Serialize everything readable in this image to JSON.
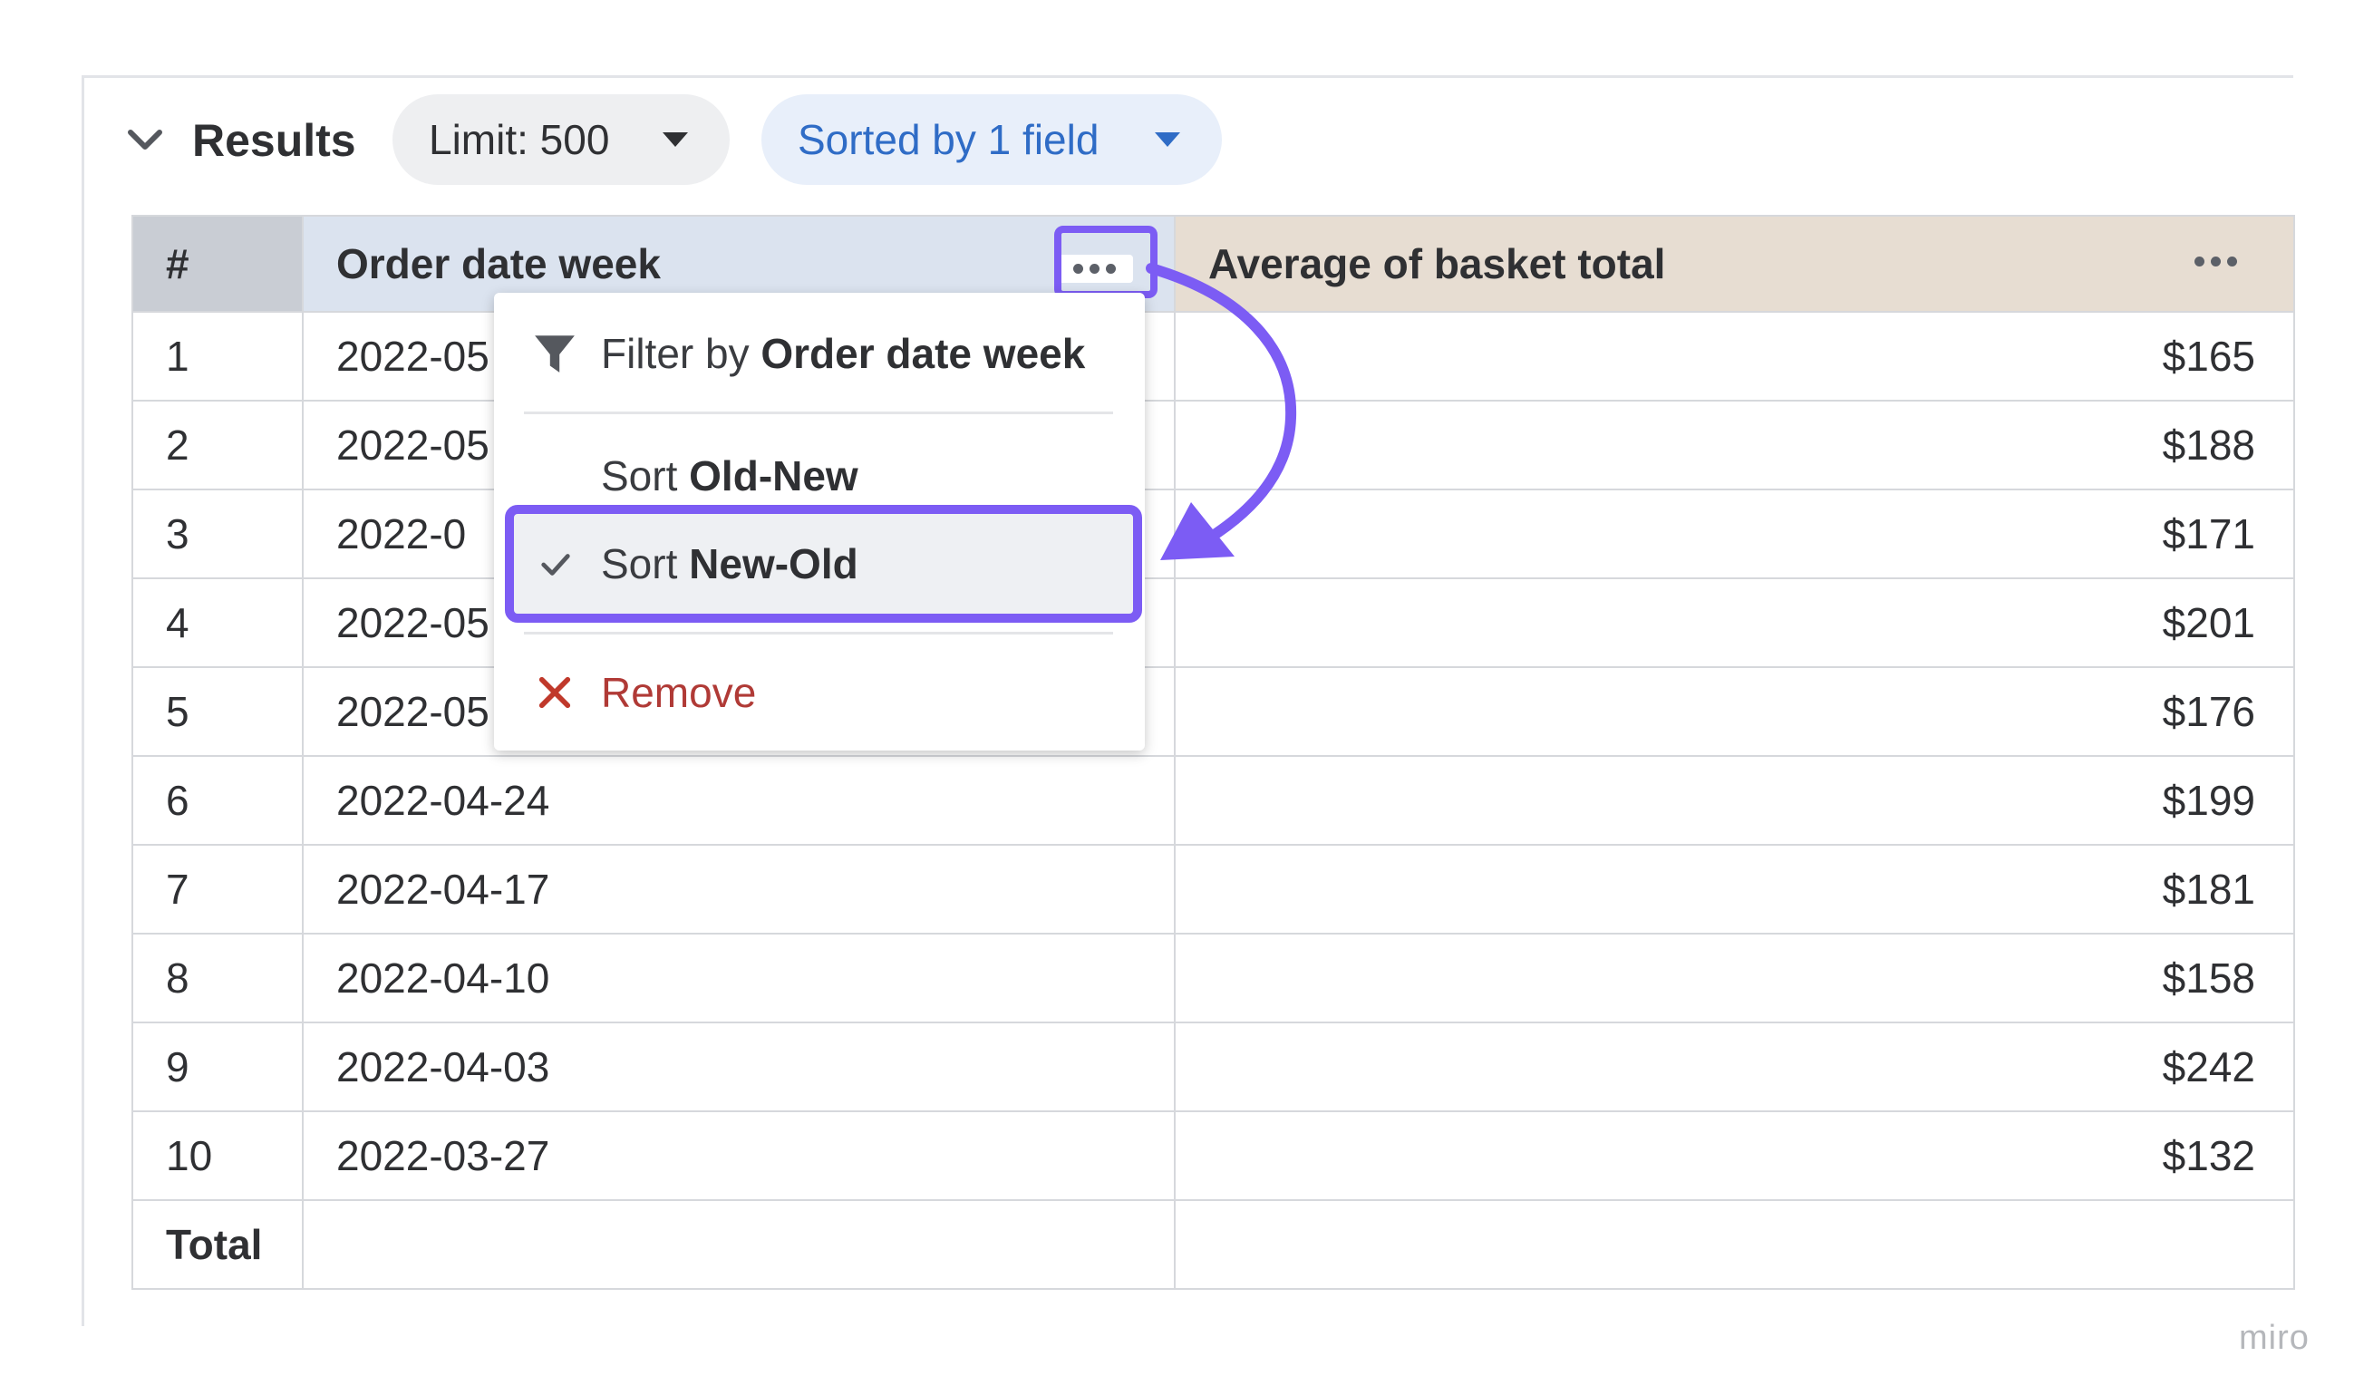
{
  "header": {
    "title": "Results",
    "limit_label": "Limit: 500",
    "sorted_label": "Sorted by 1 field"
  },
  "table": {
    "columns": [
      "#",
      "Order date week",
      "Average of basket total"
    ],
    "rows": [
      {
        "n": "1",
        "date": "2022-05",
        "avg": "$165"
      },
      {
        "n": "2",
        "date": "2022-05",
        "avg": "$188"
      },
      {
        "n": "3",
        "date": "2022-0",
        "avg": "$171"
      },
      {
        "n": "4",
        "date": "2022-05",
        "avg": "$201"
      },
      {
        "n": "5",
        "date": "2022-05",
        "avg": "$176"
      },
      {
        "n": "6",
        "date": "2022-04-24",
        "avg": "$199"
      },
      {
        "n": "7",
        "date": "2022-04-17",
        "avg": "$181"
      },
      {
        "n": "8",
        "date": "2022-04-10",
        "avg": "$158"
      },
      {
        "n": "9",
        "date": "2022-04-03",
        "avg": "$242"
      },
      {
        "n": "10",
        "date": "2022-03-27",
        "avg": "$132"
      }
    ],
    "total_label": "Total"
  },
  "menu": {
    "filter_prefix": "Filter by ",
    "filter_field": "Order date week",
    "sort_prefix": "Sort ",
    "sort_old_new": "Old-New",
    "sort_new_old": "Sort ",
    "sort_new_old_bold": "New-Old",
    "remove": "Remove"
  },
  "watermark": "miro",
  "colors": {
    "accent": "#7c5cf4",
    "link_blue": "#2f6cc6",
    "remove_red": "#b03a36",
    "header_date_bg": "#dbe3ef",
    "header_avg_bg": "#e7ddd2"
  },
  "icons": [
    "chevron-down-icon",
    "caret-down-icon",
    "more-dots-icon",
    "filter-funnel-icon",
    "checkmark-icon",
    "close-x-icon",
    "curved-arrow-annotation"
  ]
}
